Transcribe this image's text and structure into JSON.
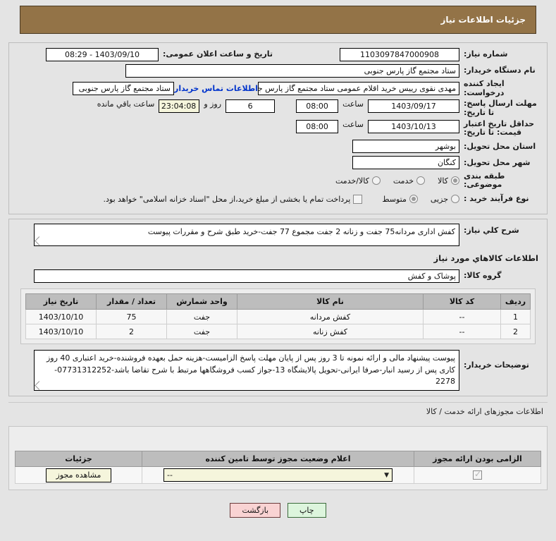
{
  "header": {
    "title": "جزئیات اطلاعات نیاز"
  },
  "form": {
    "need_number_label": "شماره نیاز:",
    "need_number_value": "1103097847000908",
    "announce_label": "تاریخ و ساعت اعلان عمومی:",
    "announce_value": "1403/09/10 - 08:29",
    "buyer_org_label": "نام دستگاه خریدار:",
    "buyer_org_value": "ستاد مجتمع گاز پارس جنوبی",
    "creator_label": "ایجاد کننده درخواست:",
    "creator_value": "مهدی نقوی رییس خرید اقلام عمومی ستاد مجتمع گاز پارس جنوبی",
    "buyer_org_secondary_value": "ستاد مجتمع گاز پارس جنوبی",
    "contact_link": "اطلاعات تماس خریدار",
    "reply_deadline_label": "مهلت ارسال پاسخ: تا تاریخ:",
    "reply_deadline_date": "1403/09/17",
    "hour_label": "ساعت",
    "reply_deadline_time": "08:00",
    "remaining_days": "6",
    "days_and_label": "روز و",
    "remaining_time": "23:04:08",
    "remaining_suffix": "ساعت باقي مانده",
    "price_validity_label": "حداقل تاریخ اعتبار قیمت: تا تاریخ:",
    "price_validity_date": "1403/10/13",
    "price_validity_time": "08:00",
    "province_label": "استان محل تحویل:",
    "province_value": "بوشهر",
    "city_label": "شهر محل تحویل:",
    "city_value": "کنگان",
    "category_label": "طبقه بندی موضوعی:",
    "category_options": [
      {
        "label": "کالا",
        "selected": true
      },
      {
        "label": "خدمت",
        "selected": false
      },
      {
        "label": "کالا/خدمت",
        "selected": false
      }
    ],
    "process_label": "نوع فرآیند خرید :",
    "process_options": [
      {
        "label": "جزیی",
        "selected": false
      },
      {
        "label": "متوسط",
        "selected": true
      }
    ],
    "treasury_checkbox_label": "پرداخت تمام یا بخشی از مبلغ خرید،از محل \"اسناد خزانه اسلامی\" خواهد بود.",
    "treasury_checked": false
  },
  "description": {
    "label": "شرح كلي نياز:",
    "value": "کفش اداری مردانه75 جفت و زنانه 2 جفت مجموع 77 جفت-خرید طبق شرح و مقررات پیوست"
  },
  "goods": {
    "section_title": "اطلاعات كالاهاي مورد نياز",
    "group_label": "گروه کالا:",
    "group_value": "پوشاک و کفش",
    "columns": [
      "ردیف",
      "کد کالا",
      "نام کالا",
      "واحد شمارش",
      "تعداد / مقدار",
      "تاریخ نیاز"
    ],
    "rows": [
      {
        "index": "1",
        "code": "--",
        "name": "کفش مردانه",
        "unit": "جفت",
        "qty": "75",
        "date": "1403/10/10"
      },
      {
        "index": "2",
        "code": "--",
        "name": "کفش زنانه",
        "unit": "جفت",
        "qty": "2",
        "date": "1403/10/10"
      }
    ]
  },
  "notes": {
    "label": "توضیحات خریدار:",
    "value": "پیوست پیشنهاد مالی و ارائه نمونه تا 3 روز پس از پایان مهلت پاسخ الزامیست-هزینه حمل بعهده فروشنده-خرید اعتباری 40 روز کاری پس از رسید انبار-صرفا ایرانی-تحویل پالایشگاه 13-جواز کسب فروشگاهها مرتبط با شرح تقاضا باشد-07731312252-2278"
  },
  "licenses": {
    "section_title": "اطلاعات مجوزهای ارائه خدمت / کالا",
    "columns": [
      "الزامی بودن ارائه مجوز",
      "اعلام وضعیت مجوز توسط تامین کننده",
      "جزئیات"
    ],
    "rows": [
      {
        "required": true,
        "status": "--",
        "detail_button": "مشاهده مجوز"
      }
    ]
  },
  "footer": {
    "print_label": "چاپ",
    "back_label": "بازگشت"
  },
  "colors": {
    "header_bar": "#937347",
    "link": "#0033cc",
    "table_header": "#bdbdbd",
    "cream": "#f5f5dc",
    "back_button": "#f9d3d3",
    "print_button": "#ddf5dd"
  }
}
